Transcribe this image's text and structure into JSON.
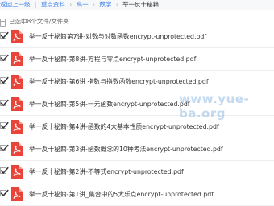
{
  "breadcrumb": {
    "back": "返回上一级",
    "items": [
      "重点资料",
      "高一",
      "数学"
    ],
    "current": "举一反十秘籍",
    "separator": "|",
    "chevron": "›"
  },
  "selection": {
    "summary": "已选中8个文件/文件夹"
  },
  "files": [
    {
      "name": "举一反十秘籍第7讲-对数与对数函数encrypt-unprotected.pdf",
      "checked": true
    },
    {
      "name": "举一反十秘籍-第8讲-方程与零点encrypt-unprotected.pdf",
      "checked": true
    },
    {
      "name": "举一反十秘籍-第6讲 指数与指数函数encrypt-unprotected.pdf",
      "checked": true
    },
    {
      "name": "举一反十秘籍-第5讲-一元函数encrypt-unprotected.pdf",
      "checked": true
    },
    {
      "name": "举一反十秘籍-第4讲-函数的4大基本性质encrypt-unprotected.pdf",
      "checked": true
    },
    {
      "name": "举一反十秘籍-第3讲-函数概念的10种考法encrypt-unprotected.pdf",
      "checked": true
    },
    {
      "name": "举一反十秘籍-第2讲-不等式encrypt-unprotected.pdf",
      "checked": true
    },
    {
      "name": "举一反十秘籍-第1讲_集合中的5大乐点encrypt-unprotected.pdf",
      "checked": true
    }
  ],
  "watermark": "www.yue-ba.org",
  "colors": {
    "accent": "#3a7de8",
    "pdf": "#e8443a",
    "row_border": "#eeeeee"
  },
  "icons": {
    "checkbox": "check-icon",
    "file": "pdf-icon"
  }
}
